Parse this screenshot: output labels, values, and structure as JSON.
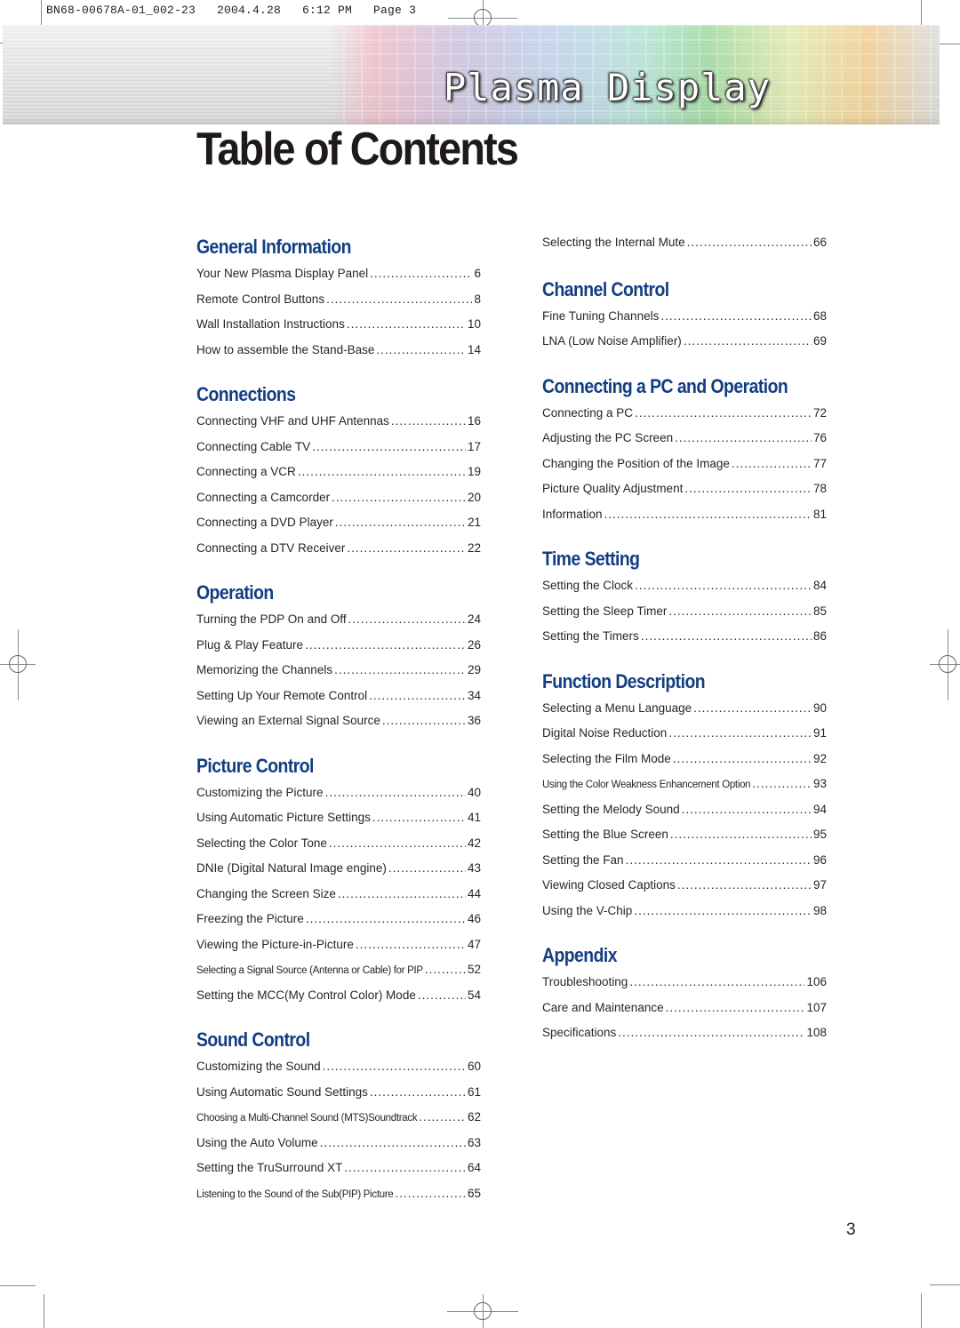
{
  "slug": {
    "text": "BN68-00678A-01_002-23   2004.4.28   6:12 PM   Page 3"
  },
  "banner": {
    "title": "Plasma Display"
  },
  "page_title": "Table of Contents",
  "left_column": [
    {
      "heading": "General Information",
      "entries": [
        {
          "label": "Your New Plasma Display Panel",
          "page": "6"
        },
        {
          "label": "Remote Control Buttons",
          "page": "8"
        },
        {
          "label": "Wall Installation Instructions",
          "page": "10"
        },
        {
          "label": "How to assemble the Stand-Base",
          "page": "14"
        }
      ]
    },
    {
      "heading": "Connections",
      "entries": [
        {
          "label": "Connecting VHF and UHF Antennas",
          "page": "16"
        },
        {
          "label": "Connecting Cable TV",
          "page": "17"
        },
        {
          "label": "Connecting a VCR",
          "page": "19"
        },
        {
          "label": "Connecting a Camcorder",
          "page": "20"
        },
        {
          "label": "Connecting a DVD Player",
          "page": "21"
        },
        {
          "label": "Connecting a DTV Receiver",
          "page": "22"
        }
      ]
    },
    {
      "heading": "Operation",
      "entries": [
        {
          "label": "Turning the PDP On and Off",
          "page": "24"
        },
        {
          "label": "Plug & Play Feature",
          "page": "26"
        },
        {
          "label": "Memorizing the Channels",
          "page": "29"
        },
        {
          "label": "Setting Up Your Remote Control",
          "page": "34"
        },
        {
          "label": "Viewing an External Signal Source",
          "page": "36"
        }
      ]
    },
    {
      "heading": "Picture Control",
      "entries": [
        {
          "label": "Customizing the Picture",
          "page": "40"
        },
        {
          "label": "Using Automatic Picture Settings",
          "page": "41"
        },
        {
          "label": "Selecting the Color Tone",
          "page": "42"
        },
        {
          "label": "DNIe (Digital Natural Image engine)",
          "page": "43"
        },
        {
          "label": "Changing the Screen Size",
          "page": "44"
        },
        {
          "label": "Freezing the Picture",
          "page": "46"
        },
        {
          "label": "Viewing the Picture-in-Picture",
          "page": "47"
        },
        {
          "label": "Selecting a Signal Source (Antenna or Cable) for PIP",
          "page": "52"
        },
        {
          "label": "Setting the MCC(My Control Color) Mode",
          "page": "54"
        }
      ]
    },
    {
      "heading": "Sound Control",
      "entries": [
        {
          "label": "Customizing the Sound",
          "page": "60"
        },
        {
          "label": "Using Automatic Sound Settings",
          "page": "61"
        },
        {
          "label": "Choosing a Multi-Channel Sound (MTS)Soundtrack",
          "page": "62"
        },
        {
          "label": "Using the Auto Volume",
          "page": "63"
        },
        {
          "label": "Setting the TruSurround XT",
          "page": "64"
        },
        {
          "label": "Listening to the Sound of the Sub(PIP) Picture",
          "page": "65"
        }
      ]
    }
  ],
  "right_column": {
    "continued_entry": {
      "label": "Selecting the Internal Mute",
      "page": "66"
    },
    "sections": [
      {
        "heading": "Channel Control",
        "entries": [
          {
            "label": "Fine Tuning Channels",
            "page": "68"
          },
          {
            "label": "LNA (Low Noise Amplifier)",
            "page": "69"
          }
        ]
      },
      {
        "heading": "Connecting a PC and Operation",
        "entries": [
          {
            "label": "Connecting a PC",
            "page": "72"
          },
          {
            "label": "Adjusting the PC Screen",
            "page": "76"
          },
          {
            "label": "Changing the Position of the Image",
            "page": "77"
          },
          {
            "label": "Picture Quality Adjustment",
            "page": "78"
          },
          {
            "label": "Information",
            "page": "81"
          }
        ]
      },
      {
        "heading": "Time Setting",
        "entries": [
          {
            "label": "Setting the Clock",
            "page": "84"
          },
          {
            "label": "Setting the Sleep Timer",
            "page": "85"
          },
          {
            "label": "Setting the Timers",
            "page": "86"
          }
        ]
      },
      {
        "heading": "Function Description",
        "entries": [
          {
            "label": "Selecting a Menu Language",
            "page": "90"
          },
          {
            "label": "Digital Noise Reduction",
            "page": "91"
          },
          {
            "label": "Selecting the Film Mode",
            "page": "92"
          },
          {
            "label": "Using the Color Weakness Enhancement Option",
            "page": "93"
          },
          {
            "label": "Setting the Melody Sound",
            "page": "94"
          },
          {
            "label": "Setting the Blue Screen",
            "page": "95"
          },
          {
            "label": "Setting the Fan",
            "page": "96"
          },
          {
            "label": "Viewing Closed Captions",
            "page": "97"
          },
          {
            "label": "Using the V-Chip",
            "page": "98"
          }
        ]
      },
      {
        "heading": "Appendix",
        "entries": [
          {
            "label": "Troubleshooting",
            "page": "106"
          },
          {
            "label": "Care and Maintenance",
            "page": "107"
          },
          {
            "label": "Specifications",
            "page": "108"
          }
        ]
      }
    ]
  },
  "page_number": "3",
  "colors": {
    "heading": "#123d82",
    "body_text": "#2a2424",
    "title": "#1f1a1a"
  }
}
